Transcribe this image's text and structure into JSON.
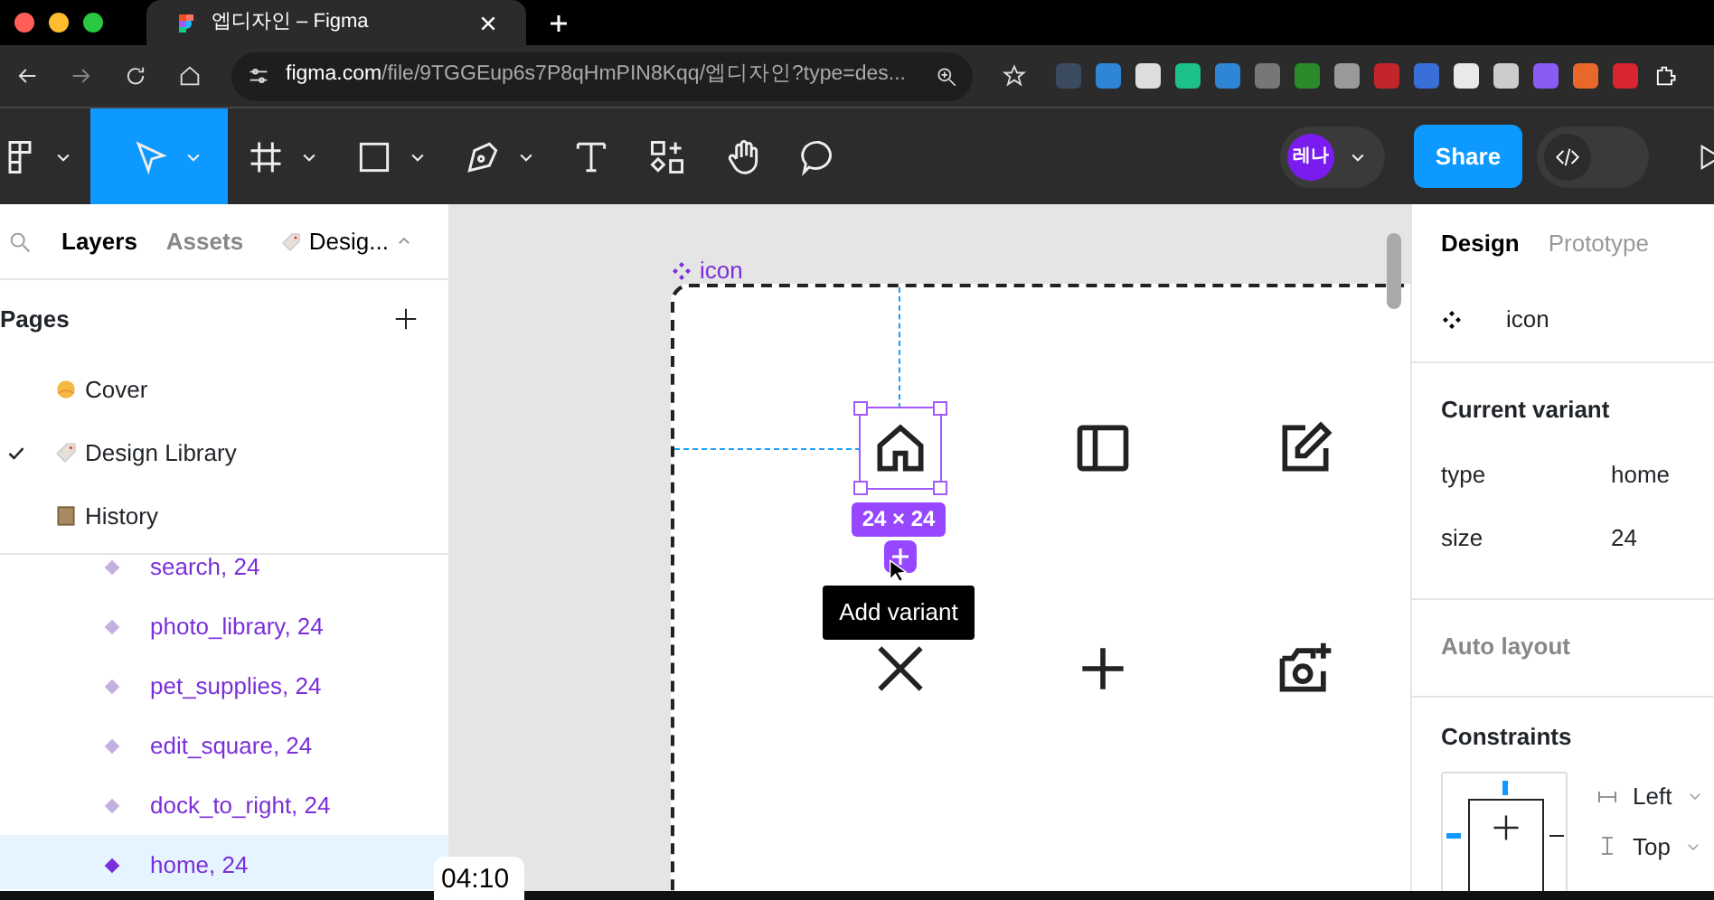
{
  "browser": {
    "tab_title": "엡디자인 – Figma",
    "url_host": "figma.com",
    "url_path": "/file/9TGGEup6s7P8qHmPIN8Kqq/엡디자인?type=des..."
  },
  "toolbar": {
    "tools": [
      {
        "kind": "menu",
        "selected": false
      },
      {
        "kind": "move",
        "selected": true
      },
      {
        "kind": "frame",
        "selected": false
      },
      {
        "kind": "shape",
        "selected": false
      },
      {
        "kind": "pen",
        "selected": false
      },
      {
        "kind": "text",
        "selected": false
      },
      {
        "kind": "resources",
        "selected": false
      },
      {
        "kind": "hand",
        "selected": false
      },
      {
        "kind": "comment",
        "selected": false
      }
    ],
    "avatar": "레나",
    "share": "Share",
    "dev_mode": false
  },
  "left_panel": {
    "tabs": [
      {
        "label": "Layers",
        "selected": true
      },
      {
        "label": "Assets",
        "selected": false
      }
    ],
    "page_switcher": "Desig...",
    "pages_heading": "Pages",
    "pages": [
      {
        "label": "Cover",
        "selected": false
      },
      {
        "label": "Design Library",
        "selected": true
      },
      {
        "label": "History",
        "selected": false
      }
    ],
    "layers": [
      {
        "label": "search, 24",
        "selected": false
      },
      {
        "label": "photo_library, 24",
        "selected": false
      },
      {
        "label": "pet_supplies, 24",
        "selected": false
      },
      {
        "label": "edit_square, 24",
        "selected": false
      },
      {
        "label": "dock_to_right, 24",
        "selected": false
      },
      {
        "label": "home, 24",
        "selected": true
      }
    ]
  },
  "canvas": {
    "frame_label": "icon",
    "icons": [
      {
        "kind": "home",
        "selected": true
      },
      {
        "kind": "panel",
        "selected": false
      },
      {
        "kind": "edit",
        "selected": false
      },
      {
        "kind": "close",
        "selected": false
      },
      {
        "kind": "plus",
        "selected": false
      },
      {
        "kind": "camera-add",
        "selected": false
      }
    ],
    "size_badge": "24 × 24",
    "tooltip": "Add variant"
  },
  "right_panel": {
    "tabs": [
      {
        "label": "Design",
        "selected": true
      },
      {
        "label": "Prototype",
        "selected": false
      }
    ],
    "component": "icon",
    "variant_heading": "Current variant",
    "properties": [
      {
        "name": "type",
        "value": "home"
      },
      {
        "name": "size",
        "value": "24"
      }
    ],
    "auto_layout": "Auto layout",
    "constraints_heading": "Constraints",
    "horizontal": "Left",
    "vertical": "Top"
  },
  "timestamp": "04:10"
}
